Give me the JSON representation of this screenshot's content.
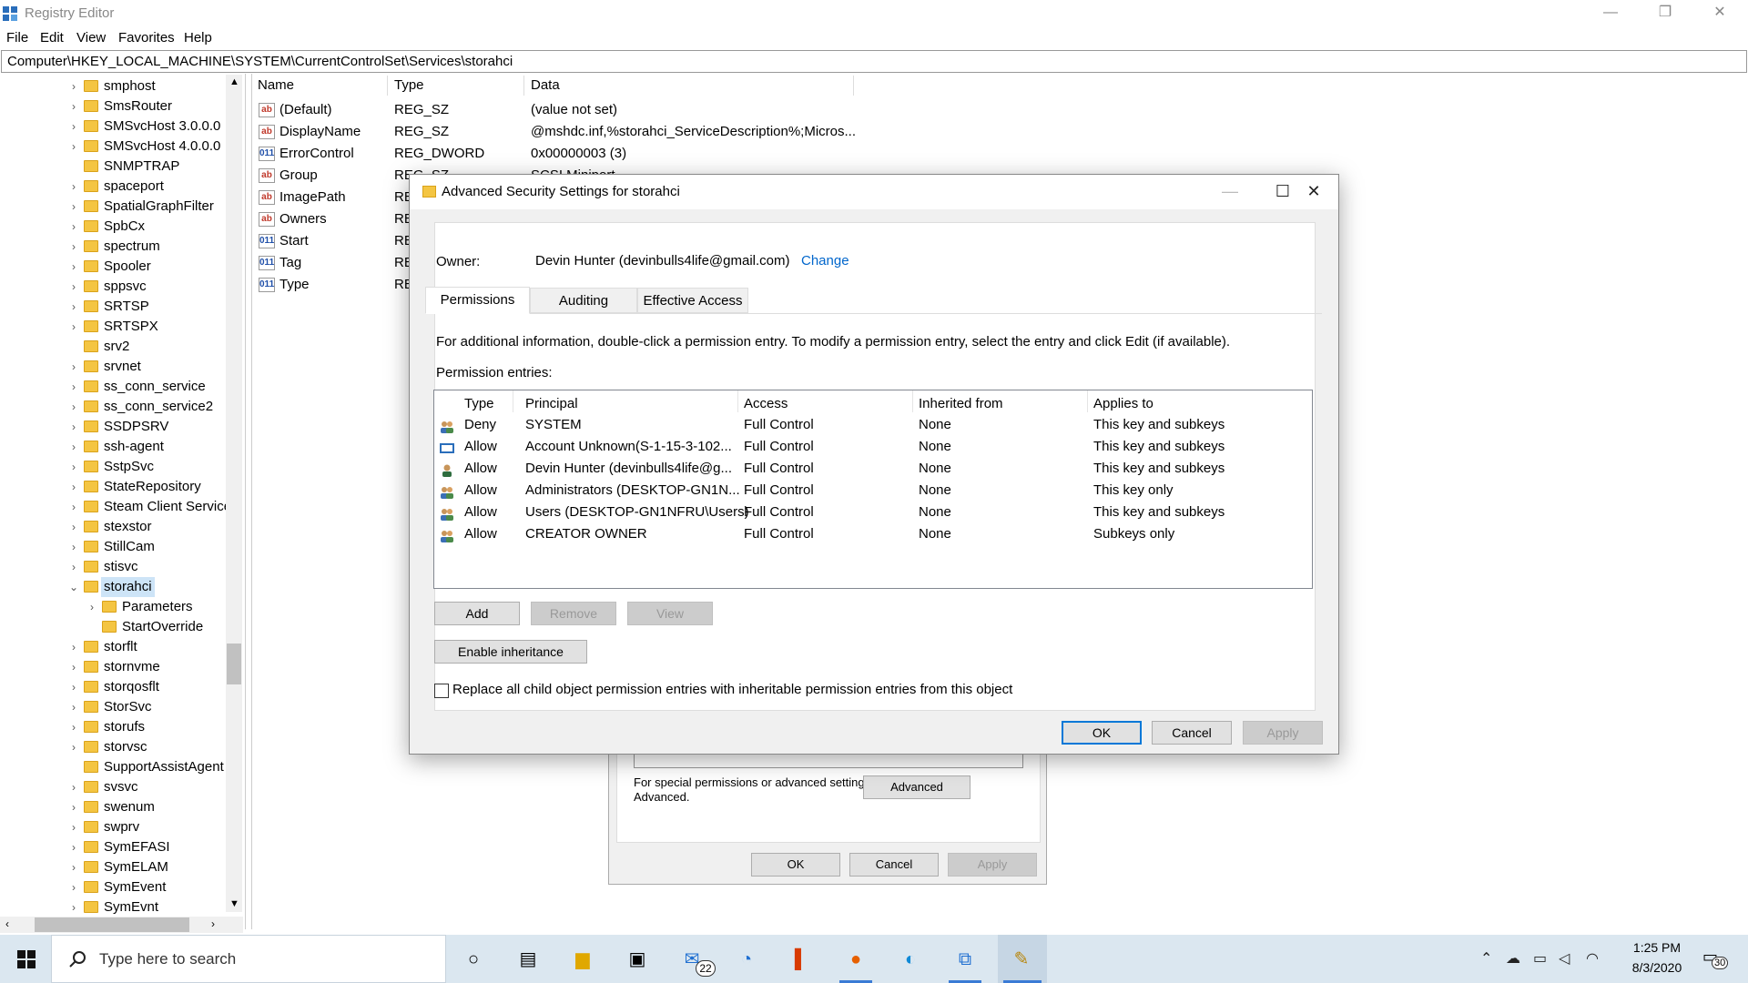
{
  "window": {
    "title": "Registry Editor",
    "min": "—",
    "max": "❐",
    "close": "✕"
  },
  "menu": [
    "File",
    "Edit",
    "View",
    "Favorites",
    "Help"
  ],
  "address": "Computer\\HKEY_LOCAL_MACHINE\\SYSTEM\\CurrentControlSet\\Services\\storahci",
  "tree": [
    {
      "label": "smphost",
      "chev": "›"
    },
    {
      "label": "SmsRouter",
      "chev": "›"
    },
    {
      "label": "SMSvcHost 3.0.0.0",
      "chev": "›"
    },
    {
      "label": "SMSvcHost 4.0.0.0",
      "chev": "›"
    },
    {
      "label": "SNMPTRAP",
      "chev": ""
    },
    {
      "label": "spaceport",
      "chev": "›"
    },
    {
      "label": "SpatialGraphFilter",
      "chev": "›"
    },
    {
      "label": "SpbCx",
      "chev": "›"
    },
    {
      "label": "spectrum",
      "chev": "›"
    },
    {
      "label": "Spooler",
      "chev": "›"
    },
    {
      "label": "sppsvc",
      "chev": "›"
    },
    {
      "label": "SRTSP",
      "chev": "›"
    },
    {
      "label": "SRTSPX",
      "chev": "›"
    },
    {
      "label": "srv2",
      "chev": ""
    },
    {
      "label": "srvnet",
      "chev": "›"
    },
    {
      "label": "ss_conn_service",
      "chev": "›"
    },
    {
      "label": "ss_conn_service2",
      "chev": "›"
    },
    {
      "label": "SSDPSRV",
      "chev": "›"
    },
    {
      "label": "ssh-agent",
      "chev": "›"
    },
    {
      "label": "SstpSvc",
      "chev": "›"
    },
    {
      "label": "StateRepository",
      "chev": "›"
    },
    {
      "label": "Steam Client Service",
      "chev": "›"
    },
    {
      "label": "stexstor",
      "chev": "›"
    },
    {
      "label": "StillCam",
      "chev": "›"
    },
    {
      "label": "stisvc",
      "chev": "›"
    },
    {
      "label": "storahci",
      "chev": "⌄",
      "selected": true
    },
    {
      "label": "Parameters",
      "chev": "›",
      "child": true
    },
    {
      "label": "StartOverride",
      "chev": "",
      "child": true
    },
    {
      "label": "storflt",
      "chev": "›"
    },
    {
      "label": "stornvme",
      "chev": "›"
    },
    {
      "label": "storqosflt",
      "chev": "›"
    },
    {
      "label": "StorSvc",
      "chev": "›"
    },
    {
      "label": "storufs",
      "chev": "›"
    },
    {
      "label": "storvsc",
      "chev": "›"
    },
    {
      "label": "SupportAssistAgent",
      "chev": ""
    },
    {
      "label": "svsvc",
      "chev": "›"
    },
    {
      "label": "swenum",
      "chev": "›"
    },
    {
      "label": "swprv",
      "chev": "›"
    },
    {
      "label": "SymEFASI",
      "chev": "›"
    },
    {
      "label": "SymELAM",
      "chev": "›"
    },
    {
      "label": "SymEvent",
      "chev": "›"
    },
    {
      "label": "SymEvnt",
      "chev": "›"
    }
  ],
  "values": {
    "headers": [
      "Name",
      "Type",
      "Data"
    ],
    "rows": [
      {
        "name": "(Default)",
        "type": "REG_SZ",
        "data": "(value not set)",
        "icon": "ab"
      },
      {
        "name": "DisplayName",
        "type": "REG_SZ",
        "data": "@mshdc.inf,%storahci_ServiceDescription%;Micros...",
        "icon": "ab"
      },
      {
        "name": "ErrorControl",
        "type": "REG_DWORD",
        "data": "0x00000003 (3)",
        "icon": "dw"
      },
      {
        "name": "Group",
        "type": "REG_SZ",
        "data": "SCSI Miniport",
        "icon": "ab"
      },
      {
        "name": "ImagePath",
        "type": "RE",
        "data": "",
        "icon": "ab"
      },
      {
        "name": "Owners",
        "type": "RE",
        "data": "",
        "icon": "ab"
      },
      {
        "name": "Start",
        "type": "RE",
        "data": "",
        "icon": "dw"
      },
      {
        "name": "Tag",
        "type": "RE",
        "data": "",
        "icon": "dw"
      },
      {
        "name": "Type",
        "type": "RE",
        "data": "",
        "icon": "dw"
      }
    ]
  },
  "backdialog": {
    "note": "For special permissions or advanced settings, click Advanced.",
    "advanced": "Advanced",
    "ok": "OK",
    "cancel": "Cancel",
    "apply": "Apply"
  },
  "dialog": {
    "title": "Advanced Security Settings for storahci",
    "owner_label": "Owner:",
    "owner_value": "Devin Hunter (devinbulls4life@gmail.com)",
    "change": "Change",
    "tabs": [
      "Permissions",
      "Auditing",
      "Effective Access"
    ],
    "info": "For additional information, double-click a permission entry. To modify a permission entry, select the entry and click Edit (if available).",
    "entries_label": "Permission entries:",
    "columns": [
      "Type",
      "Principal",
      "Access",
      "Inherited from",
      "Applies to"
    ],
    "entries": [
      {
        "type": "Deny",
        "principal": "SYSTEM",
        "access": "Full Control",
        "inherited": "None",
        "applies": "This key and subkeys",
        "icon": "group-icon"
      },
      {
        "type": "Allow",
        "principal": "Account Unknown(S-1-15-3-102...",
        "access": "Full Control",
        "inherited": "None",
        "applies": "This key and subkeys",
        "icon": "unknown-account-icon"
      },
      {
        "type": "Allow",
        "principal": "Devin Hunter (devinbulls4life@g...",
        "access": "Full Control",
        "inherited": "None",
        "applies": "This key and subkeys",
        "icon": "user-icon"
      },
      {
        "type": "Allow",
        "principal": "Administrators (DESKTOP-GN1N...",
        "access": "Full Control",
        "inherited": "None",
        "applies": "This key only",
        "icon": "group-icon"
      },
      {
        "type": "Allow",
        "principal": "Users (DESKTOP-GN1NFRU\\Users)",
        "access": "Full Control",
        "inherited": "None",
        "applies": "This key and subkeys",
        "icon": "group-icon"
      },
      {
        "type": "Allow",
        "principal": "CREATOR OWNER",
        "access": "Full Control",
        "inherited": "None",
        "applies": "Subkeys only",
        "icon": "group-icon"
      }
    ],
    "add": "Add",
    "remove": "Remove",
    "view": "View",
    "enable_inheritance": "Enable inheritance",
    "replace_label": "Replace all child object permission entries with inheritable permission entries from this object",
    "ok": "OK",
    "cancel": "Cancel",
    "apply": "Apply"
  },
  "taskbar": {
    "search_placeholder": "Type here to search",
    "mail_badge": "22",
    "time": "1:25 PM",
    "date": "8/3/2020",
    "notif": "30"
  }
}
